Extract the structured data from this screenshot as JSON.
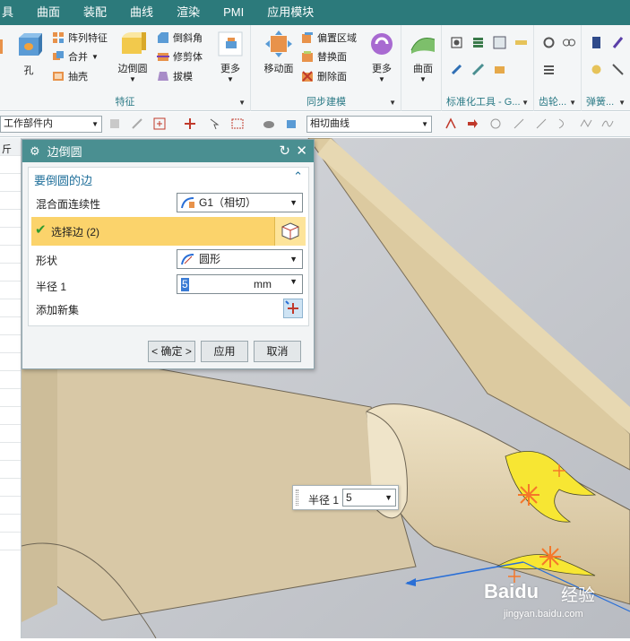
{
  "menubar": {
    "items": [
      "具",
      "曲面",
      "装配",
      "曲线",
      "渲染",
      "PMI",
      "应用模块"
    ]
  },
  "ribbon": {
    "feature_group": {
      "label": "特征",
      "hole_label": "孔",
      "pattern_feature_label": "阵列特征",
      "unite_label": "合并",
      "shell_label": "抽壳",
      "edge_blend_label": "边倒圆",
      "chamfer_label": "倒斜角",
      "trim_body_label": "修剪体",
      "draft_label": "拔模",
      "more_label": "更多"
    },
    "sync_group": {
      "label": "同步建模",
      "move_face_label": "移动面",
      "offset_region_label": "偏置区域",
      "replace_face_label": "替换面",
      "delete_face_label": "删除面",
      "more_label": "更多"
    },
    "surface_group": {
      "surface_label": "曲面"
    },
    "standard_group": {
      "label": "标准化工具 - G..."
    },
    "gear_group": {
      "label": "齿轮..."
    },
    "spring_group": {
      "label": "弹簧..."
    }
  },
  "toolbar2": {
    "scope_combo": "工作部件内",
    "curve_rule_combo": "相切曲线"
  },
  "left_panel": {
    "header": "斤"
  },
  "dialog": {
    "title": "边倒圆",
    "section_title": "要倒圆的边",
    "blend_continuity_label": "混合面连续性",
    "blend_continuity_value": "G1（相切）",
    "select_edge_label": "选择边 (2)",
    "shape_label": "形状",
    "shape_value": "圆形",
    "radius_label": "半径 1",
    "radius_value": "5",
    "radius_unit": "mm",
    "add_new_set_label": "添加新集",
    "ok_label": "< 确定 >",
    "apply_label": "应用",
    "cancel_label": "取消"
  },
  "float_tip": {
    "label": "半径 1",
    "value": "5"
  },
  "watermark": {
    "brand": "Baidu",
    "brand_cn": "经验",
    "url": "jingyan.baidu.com"
  },
  "colors": {
    "menubar": "#2c7a7b",
    "dialog_title": "#4a8f91",
    "selection_row": "#fbd36b",
    "blend_preview": "#f7e633",
    "part_face": "#d8c8a6",
    "viewport_bg": "#c5c8cd"
  }
}
